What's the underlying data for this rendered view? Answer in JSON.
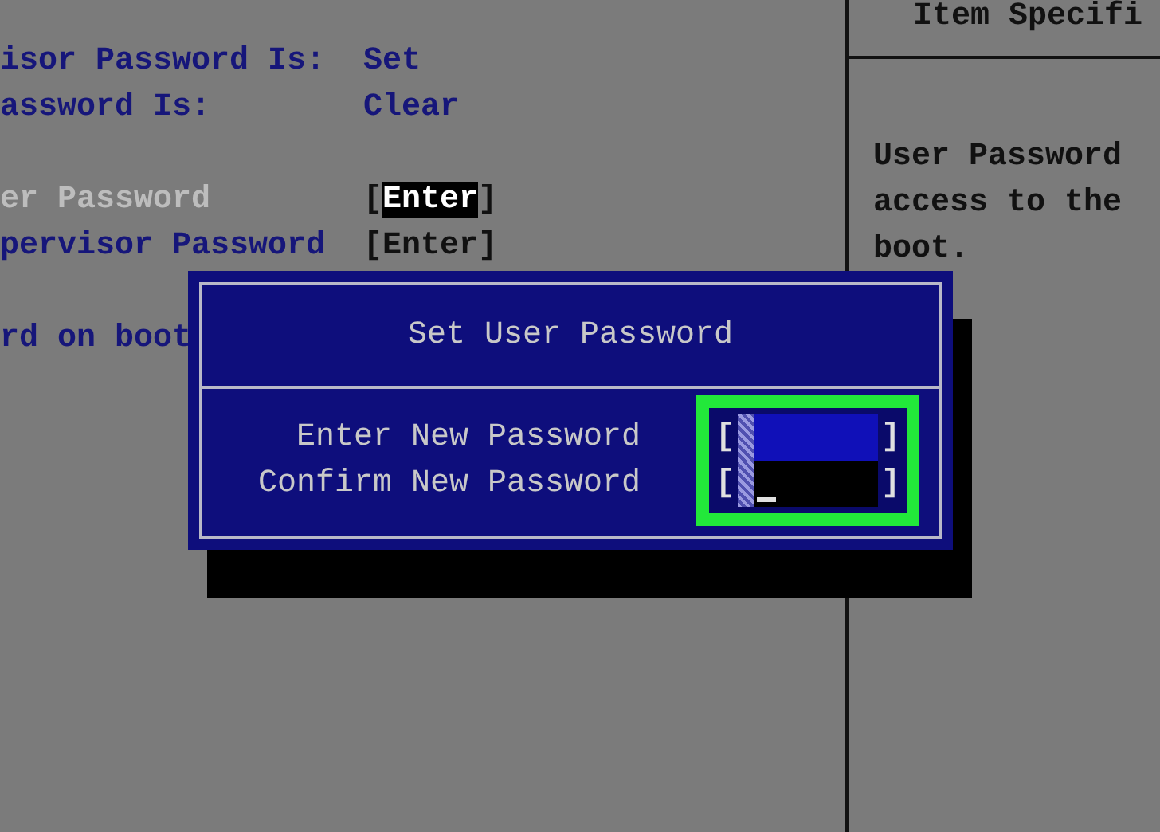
{
  "menu": {
    "groups": [
      {
        "rows": [
          {
            "kind": "status",
            "label": "isor Password Is:",
            "value": "Set",
            "selected": false
          },
          {
            "kind": "status",
            "label": "assword Is:",
            "value": "Clear",
            "selected": false
          }
        ]
      },
      {
        "rows": [
          {
            "kind": "action",
            "label": "er Password",
            "open": "[",
            "value": "Enter",
            "close": "]",
            "selected": true
          },
          {
            "kind": "action",
            "label": "pervisor Password",
            "open": "[",
            "value": "Enter",
            "close": "]",
            "selected": false
          }
        ]
      },
      {
        "rows": [
          {
            "kind": "option",
            "label": "rd on boot",
            "selected": false
          }
        ]
      }
    ]
  },
  "help_panel": {
    "title": "Item Specifi",
    "lines": [
      "User Password",
      "access to the",
      "boot."
    ]
  },
  "dialog": {
    "title": "Set User Password",
    "fields": [
      {
        "label": "Enter New Password",
        "open": "[",
        "close": "]",
        "active": false
      },
      {
        "label": "Confirm New Password",
        "open": "[",
        "close": "]",
        "active": true
      }
    ]
  }
}
